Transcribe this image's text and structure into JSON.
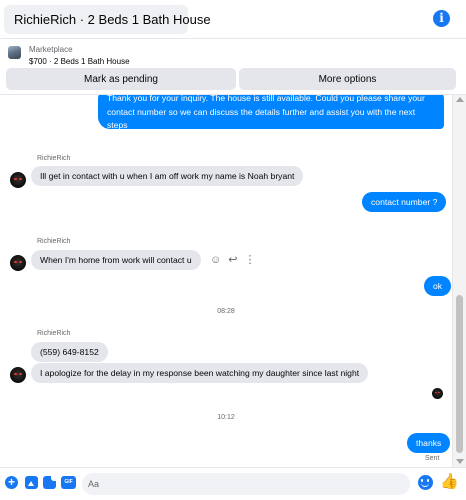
{
  "header": {
    "title": "RichieRich · 2 Beds 1 Bath House",
    "info_icon": "info-icon"
  },
  "marketplace": {
    "label": "Marketplace",
    "price_title": "$700 · 2 Beds 1 Bath House",
    "pending_button": "Mark as pending",
    "more_button": "More options"
  },
  "thread": {
    "messages": [
      {
        "from": "me",
        "text": "Thank you for your inquiry. The house is still available. Could you please share your contact number so we can discuss the details further and assist you with the next steps"
      },
      {
        "from": "RichieRich",
        "sender_label": "RichieRich",
        "text": "Ill get in contact with u when I am off work my name is Noah bryant"
      },
      {
        "from": "me",
        "text": "contact number ?"
      },
      {
        "from": "RichieRich",
        "sender_label": "RichieRich",
        "text": "When I'm home from work will contact u"
      },
      {
        "from": "me",
        "text": "ok"
      },
      {
        "type": "timestamp",
        "text": "08:28"
      },
      {
        "from": "RichieRich",
        "sender_label": "RichieRich",
        "text": "(559) 649-8152"
      },
      {
        "from": "RichieRich",
        "text": "I apologize for the delay in my response been watching my daughter since last night"
      },
      {
        "type": "timestamp",
        "text": "10:12"
      },
      {
        "from": "me",
        "text": "thanks"
      }
    ],
    "sent_status": "Sent"
  },
  "composer": {
    "placeholder": "Aa",
    "icons": [
      "plus-icon",
      "photo-icon",
      "sticker-icon",
      "gif-icon",
      "emoji-icon",
      "like-icon"
    ],
    "gif_label": "GIF"
  },
  "colors": {
    "accent": "#1877f2",
    "outgoing_bubble": "#0084ff",
    "incoming_bubble": "#e4e6eb"
  }
}
